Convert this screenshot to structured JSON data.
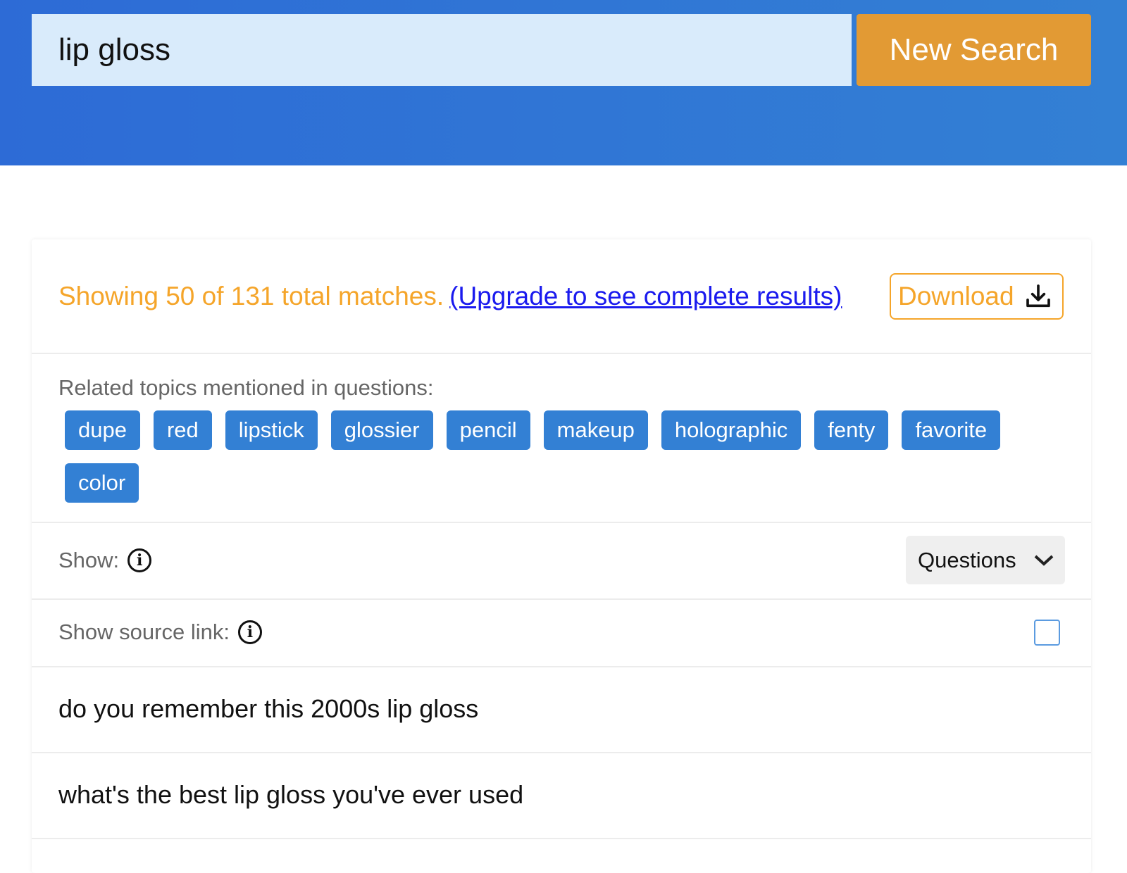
{
  "search": {
    "value": "lip gloss",
    "button": "New Search"
  },
  "summary": {
    "text": "Showing 50 of 131 total matches.",
    "upgrade_link": "(Upgrade to see complete results)",
    "download": "Download"
  },
  "topics": {
    "label": "Related topics mentioned in questions:",
    "chips": [
      "dupe",
      "red",
      "lipstick",
      "glossier",
      "pencil",
      "makeup",
      "holographic",
      "fenty",
      "favorite",
      "color"
    ]
  },
  "show": {
    "label": "Show:",
    "selected": "Questions"
  },
  "source": {
    "label": "Show source link:",
    "checked": false
  },
  "results": [
    "do you remember this 2000s lip gloss",
    "what's the best lip gloss you've ever used"
  ],
  "colors": {
    "header": "#2d6bd6",
    "accent": "#e29a34",
    "chip": "#3380d4"
  }
}
